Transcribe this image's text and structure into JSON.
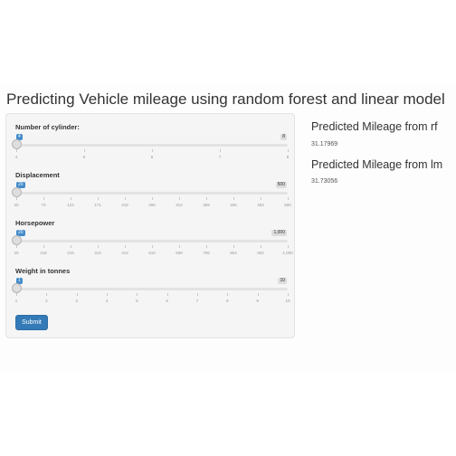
{
  "app": {
    "title": "Predicting Vehicle mileage using random forest and linear model"
  },
  "sidebar": {
    "sliders": [
      {
        "label": "Number of cylinder:",
        "min_label": "4",
        "max_label": "8",
        "value": 4,
        "min": 4,
        "max": 8,
        "ticks": [
          "4",
          "5",
          "6",
          "7",
          "8"
        ]
      },
      {
        "label": "Displacement",
        "min_label": "20",
        "max_label": "500",
        "value": 20,
        "min": 20,
        "max": 500,
        "ticks": [
          "20",
          "73",
          "124",
          "171",
          "218",
          "265",
          "312",
          "359",
          "406",
          "453",
          "500"
        ]
      },
      {
        "label": "Horsepower",
        "min_label": "20",
        "max_label": "1,000",
        "value": 20,
        "min": 20,
        "max": 1000,
        "ticks": [
          "20",
          "118",
          "216",
          "314",
          "412",
          "510",
          "608",
          "706",
          "804",
          "902",
          "1,000"
        ]
      },
      {
        "label": "Weight in tonnes",
        "min_label": "1",
        "max_label": "10",
        "value": 1,
        "min": 1,
        "max": 10,
        "ticks": [
          "1",
          "2",
          "3",
          "4",
          "5",
          "6",
          "7",
          "8",
          "9",
          "10"
        ]
      }
    ],
    "submit_label": "Submit"
  },
  "output": {
    "rf_heading": "Predicted Mileage from rf",
    "rf_value": "31.17969",
    "lm_heading": "Predicted Mileage from lm",
    "lm_value": "31.73056"
  },
  "colors": {
    "accent": "#337ab7",
    "slider_badge": "#428bca"
  }
}
